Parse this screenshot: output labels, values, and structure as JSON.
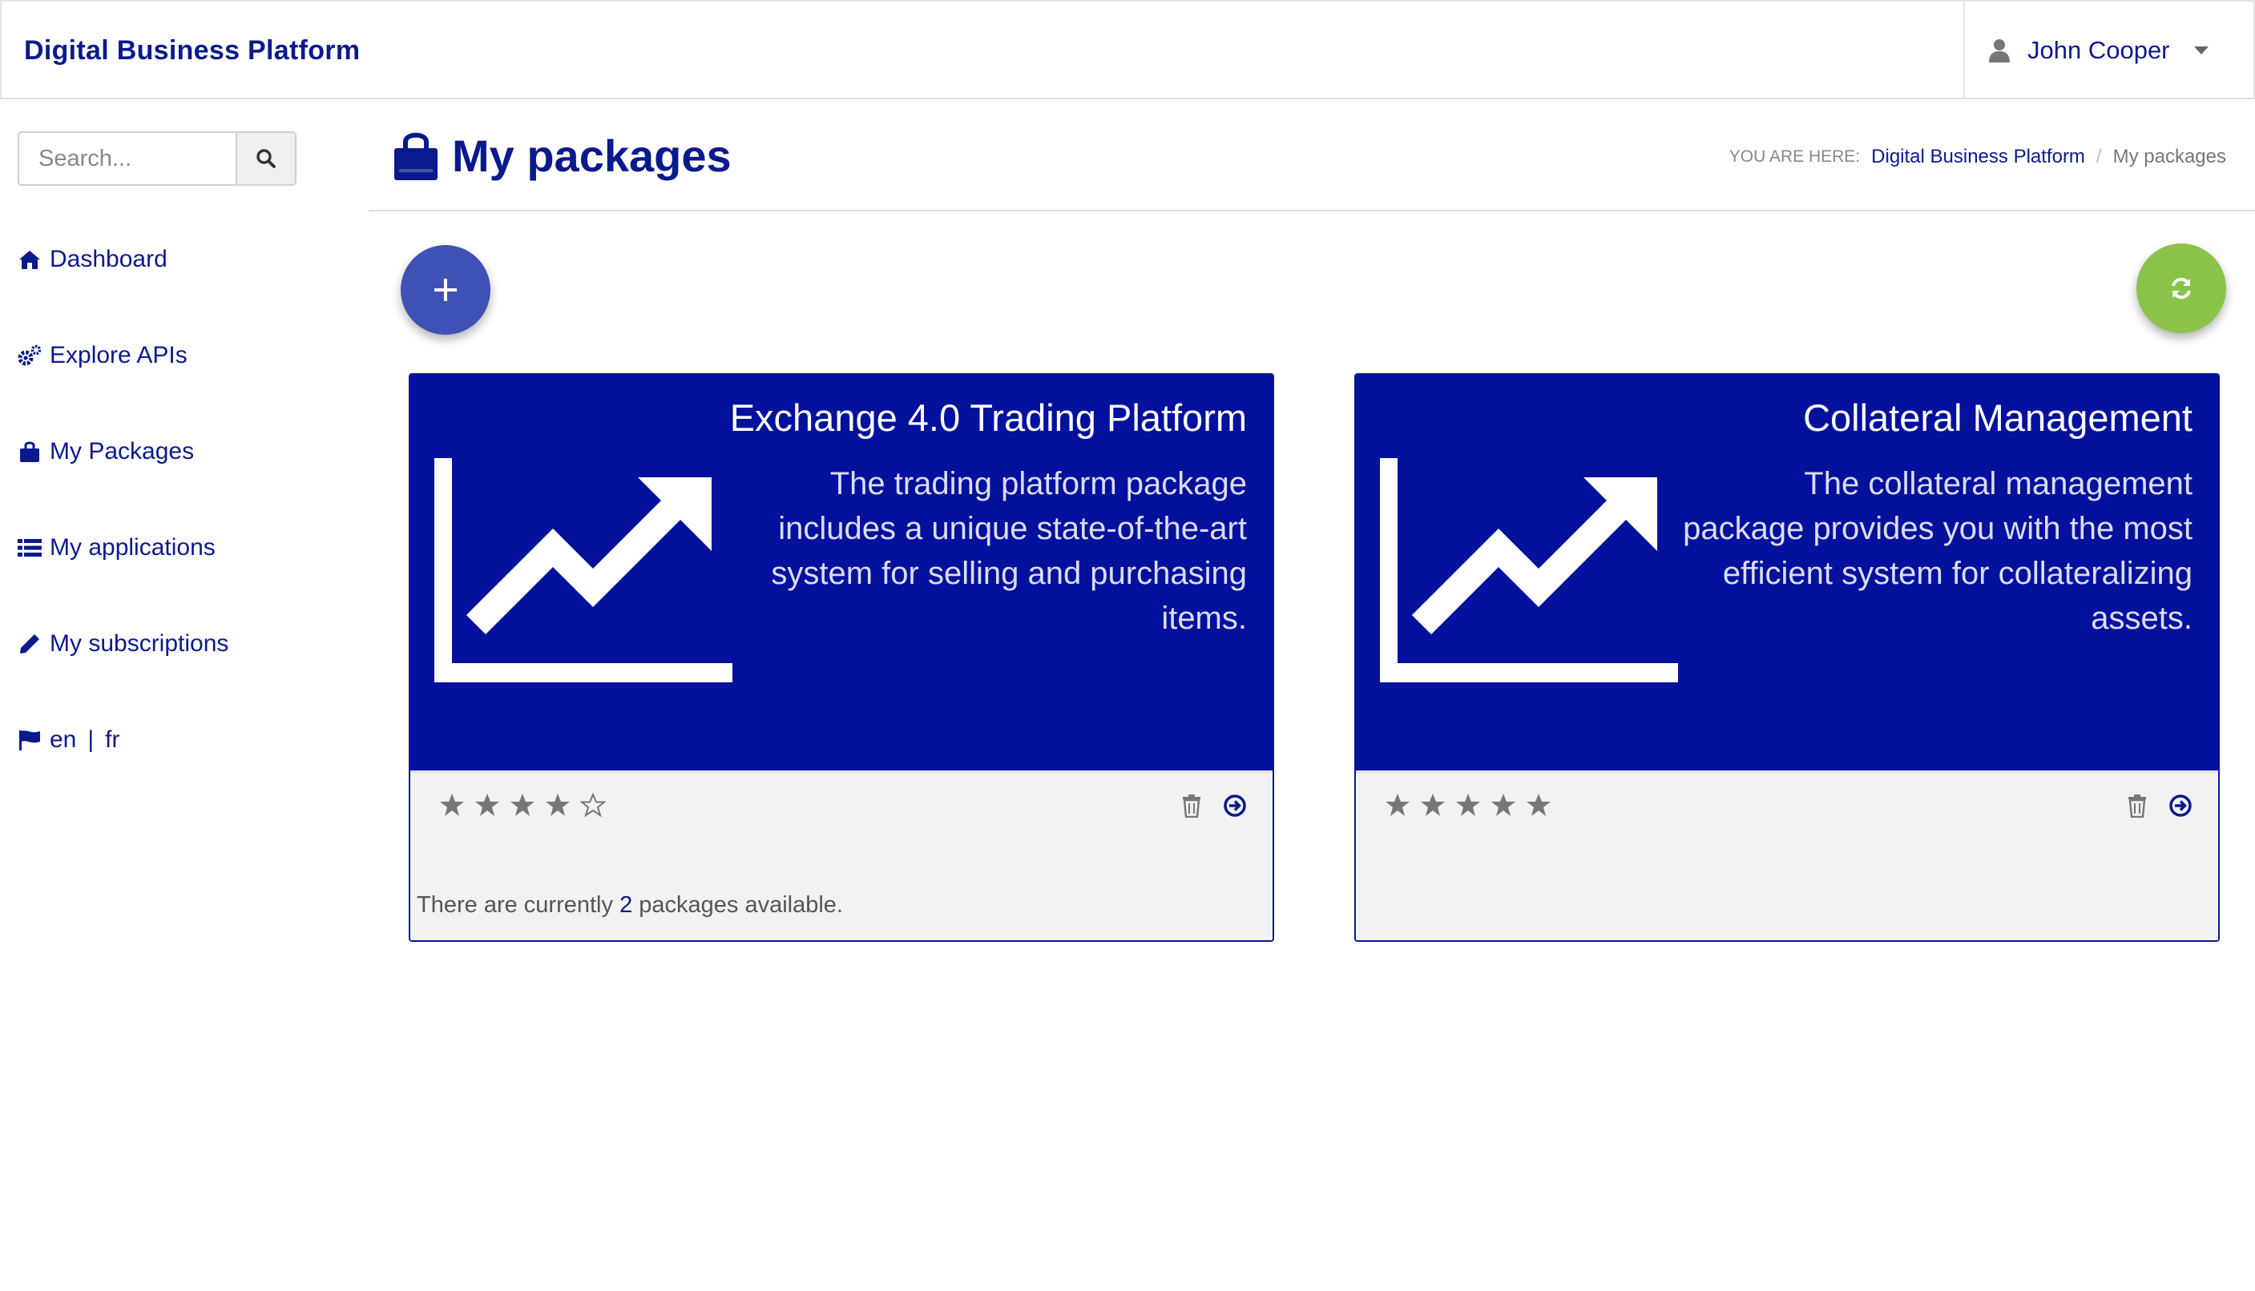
{
  "header": {
    "brand": "Digital Business Platform",
    "user_name": "John Cooper"
  },
  "sidebar": {
    "search_placeholder": "Search...",
    "items": [
      {
        "label": "Dashboard",
        "icon": "home-icon"
      },
      {
        "label": "Explore APIs",
        "icon": "cogs-icon"
      },
      {
        "label": "My Packages",
        "icon": "shopping-bag-icon"
      },
      {
        "label": "My applications",
        "icon": "list-icon"
      },
      {
        "label": "My subscriptions",
        "icon": "pencil-icon"
      }
    ],
    "languages": {
      "icon": "flag-icon",
      "en": "en",
      "sep": "|",
      "fr": "fr"
    }
  },
  "page": {
    "title": "My packages",
    "title_icon": "shopping-bag-icon",
    "breadcrumb": {
      "prefix": "YOU ARE HERE:",
      "link": "Digital Business Platform",
      "separator": "/",
      "current": "My packages"
    }
  },
  "actions": {
    "add_icon": "plus-icon",
    "refresh_icon": "refresh-icon"
  },
  "packages": [
    {
      "title": "Exchange 4.0 Trading Platform",
      "description": "The trading platform package includes a unique state-of-the-art system for selling and purchasing items.",
      "icon": "line-chart-icon",
      "rating": 4,
      "rating_max": 5
    },
    {
      "title": "Collateral Management",
      "description": "The collateral management package provides you with the most efficient system for collateralizing assets.",
      "icon": "line-chart-icon",
      "rating": 5,
      "rating_max": 5
    }
  ],
  "summary": {
    "prefix": "There are currently",
    "count": "2",
    "suffix": "packages available."
  },
  "colors": {
    "brand_blue": "#0a1a8c",
    "card_blue": "#03119c",
    "fab_add": "#3f51b5",
    "fab_refresh": "#8bc34a"
  }
}
